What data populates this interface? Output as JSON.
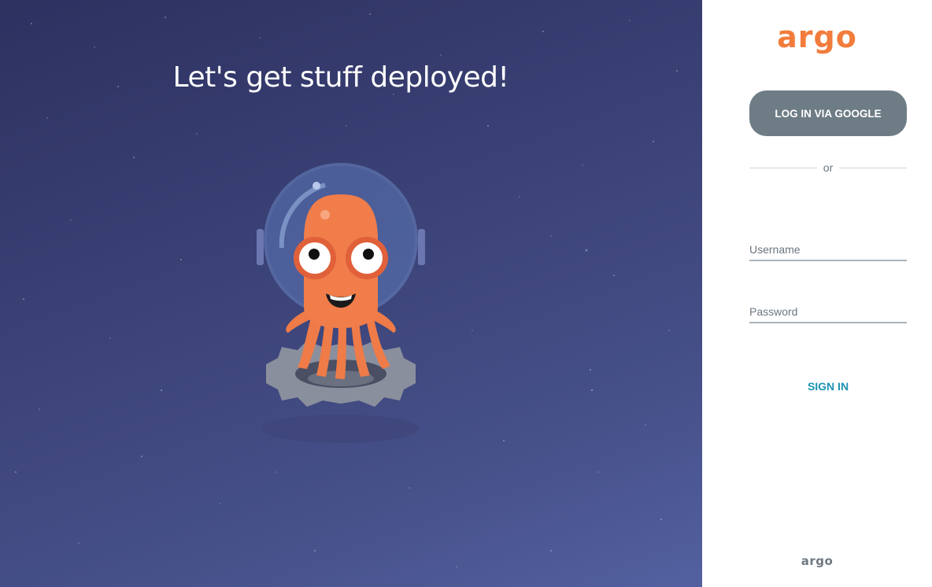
{
  "hero": {
    "title": "Let's get stuff deployed!"
  },
  "login": {
    "logo_text": "argo",
    "google_button_label": "LOG IN VIA GOOGLE",
    "divider_text": "or",
    "username": {
      "placeholder": "Username",
      "value": ""
    },
    "password": {
      "placeholder": "Password",
      "value": ""
    },
    "sign_in_label": "SIGN IN",
    "footer_logo_text": "argo"
  },
  "colors": {
    "brand_orange": "#f27c3c",
    "google_button_bg": "#6e7c85",
    "sign_in_text": "#1d93b3",
    "hero_bg_dark": "#2d3160",
    "hero_bg_light": "#5361a0"
  },
  "icons": {
    "mascot": "argo-octopus-astronaut-mascot"
  }
}
